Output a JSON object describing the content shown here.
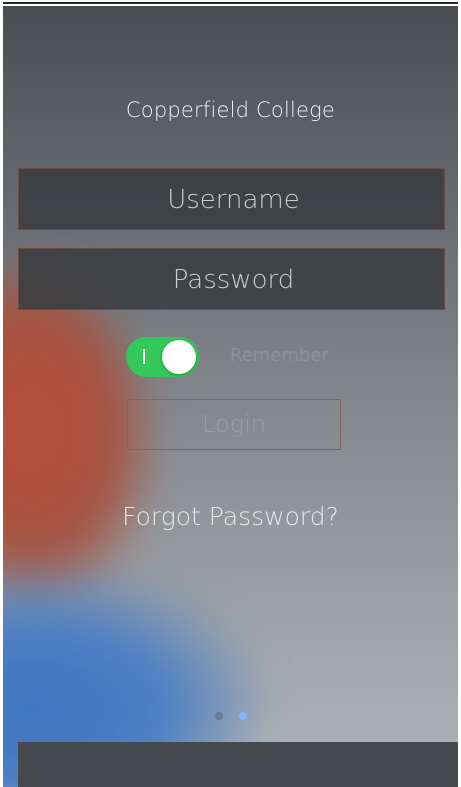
{
  "app": {
    "title": "Copperfield College"
  },
  "form": {
    "username_placeholder": "Username",
    "password_placeholder": "Password",
    "remember_label": "Remember",
    "remember_on": true,
    "login_label": "Login",
    "forgot_label": "Forgot Password?"
  },
  "pager": {
    "page_count": 2,
    "current_page": 2
  },
  "colors": {
    "toggle_on": "#34c759",
    "field_border": "#6d4b46",
    "active_dot": "#7fb5ff"
  }
}
